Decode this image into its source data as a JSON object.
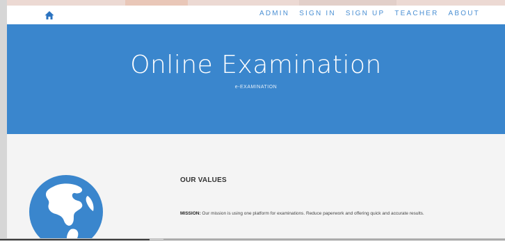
{
  "nav": {
    "home_icon": "home-icon",
    "links": [
      "ADMIN",
      "SIGN IN",
      "SIGN UP",
      "TEACHER",
      "ABOUT"
    ]
  },
  "hero": {
    "title": "Online Examination",
    "subtitle": "e-EXAMINATION"
  },
  "values": {
    "title": "OUR VALUES",
    "mission_label": "MISSION:",
    "mission_text": " Our mission is using one platform for examinations. Reduce paperwork and offering quick and accurate results."
  },
  "icons": {
    "globe": "globe-icon"
  },
  "colors": {
    "primary": "#3a86cd",
    "nav_text": "#4a8fd3",
    "content_bg": "#f4f4f4"
  }
}
